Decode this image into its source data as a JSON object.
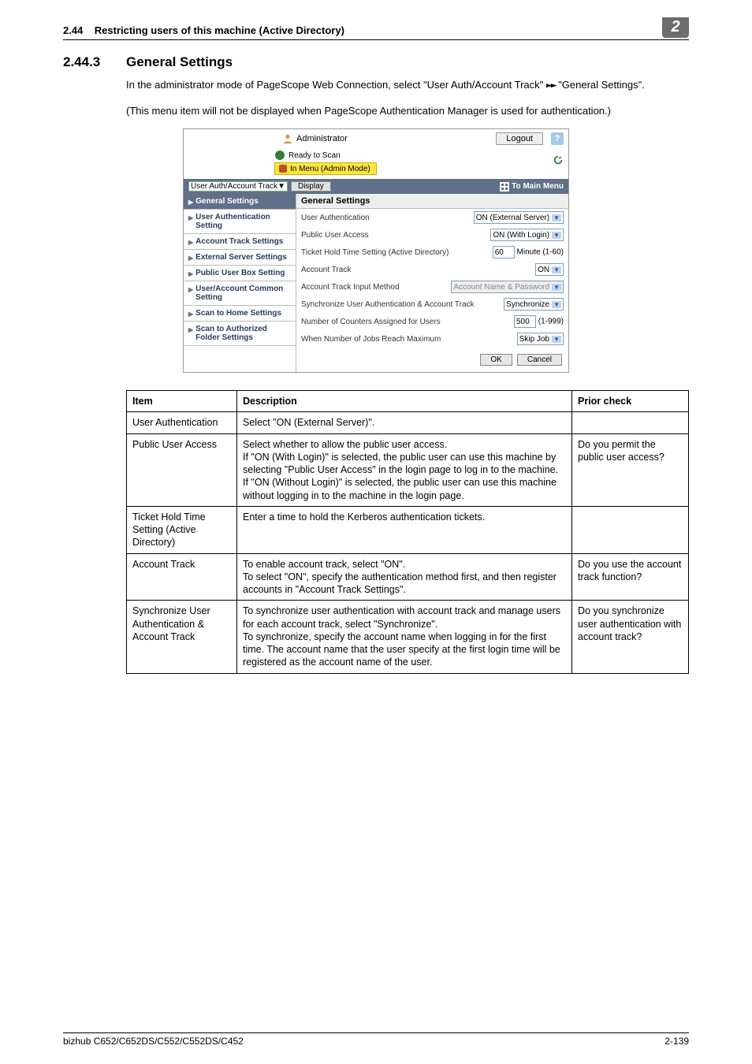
{
  "header": {
    "section_ref": "2.44",
    "section_title": "Restricting users of this machine (Active Directory)",
    "chapter_badge": "2"
  },
  "heading": {
    "number": "2.44.3",
    "title": "General Settings"
  },
  "intro": {
    "p1a": "In the administrator mode of PageScope Web Connection, select \"User Auth/Account Track\" ",
    "p1b": " \"General Settings\".",
    "p2": "(This menu item will not be displayed when PageScope Authentication Manager is used for authentication.)"
  },
  "shot": {
    "administrator": "Administrator",
    "logout": "Logout",
    "help": "?",
    "ready": "Ready to Scan",
    "in_menu": "In Menu (Admin Mode)",
    "tab_select": "User Auth/Account Track",
    "display": "Display",
    "to_main": "To Main Menu",
    "sidebar": [
      "General Settings",
      "User Authentication Setting",
      "Account Track Settings",
      "External Server Settings",
      "Public User Box Setting",
      "User/Account Common Setting",
      "Scan to Home Settings",
      "Scan to Authorized Folder Settings"
    ],
    "pane_title": "General Settings",
    "rows": {
      "user_auth_lbl": "User Authentication",
      "user_auth_val": "ON (External Server)",
      "public_lbl": "Public User Access",
      "public_val": "ON (With Login)",
      "ticket_lbl": "Ticket Hold Time Setting (Active Directory)",
      "ticket_val": "60",
      "ticket_suffix": "Minute (1-60)",
      "acct_track_lbl": "Account Track",
      "acct_track_val": "ON",
      "acct_input_lbl": "Account Track Input Method",
      "acct_input_val": "Account Name & Password",
      "sync_lbl": "Synchronize User Authentication & Account Track",
      "sync_val": "Synchronize",
      "counters_lbl": "Number of Counters Assigned for Users",
      "counters_val": "500",
      "counters_suffix": "(1-999)",
      "jobs_lbl": "When Number of Jobs Reach Maximum",
      "jobs_val": "Skip Job"
    },
    "ok": "OK",
    "cancel": "Cancel"
  },
  "table": {
    "h1": "Item",
    "h2": "Description",
    "h3": "Prior check",
    "r1c1": "User Authentication",
    "r1c2": "Select \"ON (External Server)\".",
    "r1c3": "",
    "r2c1": "Public User Access",
    "r2c2": "Select whether to allow the public user access.\nIf \"ON (With Login)\" is selected, the public user can use this machine by selecting \"Public User Access\" in the login page to log in to the machine.\nIf \"ON (Without Login)\" is selected, the public user can use this machine without logging in to the machine in the login page.",
    "r2c3": "Do you permit the public user access?",
    "r3c1": "Ticket Hold Time Setting (Active Directory)",
    "r3c2": "Enter a time to hold the Kerberos authentication tickets.",
    "r3c3": "",
    "r4c1": "Account Track",
    "r4c2": "To enable account track, select \"ON\".\nTo select \"ON\", specify the authentication method first, and then register accounts in \"Account Track Settings\".",
    "r4c3": "Do you use the account track function?",
    "r5c1": "Synchronize User Authentication & Account Track",
    "r5c2": "To synchronize user authentication with account track and manage users for each account track, select \"Synchronize\".\nTo synchronize, specify the account name when logging in for the first time. The account name that the user specify at the first login time will be registered as the account name of the user.",
    "r5c3": "Do you synchronize user authentication with account track?"
  },
  "footer": {
    "left": "bizhub C652/C652DS/C552/C552DS/C452",
    "right": "2-139"
  }
}
